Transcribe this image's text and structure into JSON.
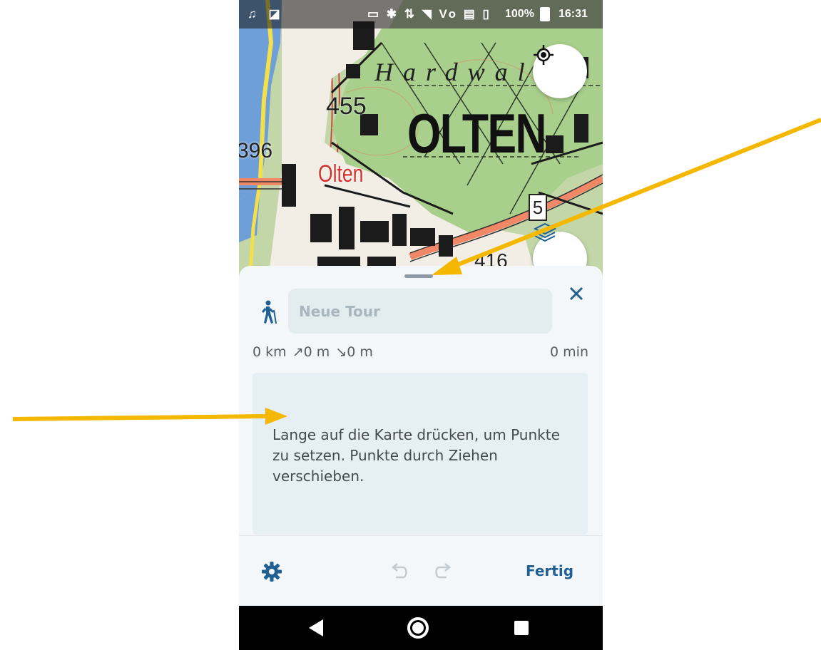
{
  "status_bar": {
    "battery": "100%",
    "time": "16:31"
  },
  "map": {
    "labels": {
      "town": "OLTEN",
      "station": "Olten",
      "forest": "Hardwal",
      "elevation_1": "455",
      "elevation_2": "396",
      "elevation_3": "416",
      "road_number": "5"
    },
    "locate_icon": "crosshair-icon",
    "layers_icon": "layers-icon"
  },
  "sheet": {
    "activity_icon": "hiker-icon",
    "title_placeholder": "Neue Tour",
    "close_icon": "close-icon",
    "stats": {
      "distance": "0 km",
      "ascent": "↗0 m",
      "descent": "↘0 m",
      "duration": "0 min"
    },
    "hint": "Lange auf die Karte drücken, um Punkte zu setzen. Punkte durch Ziehen verschieben."
  },
  "toolbar": {
    "settings_icon": "gear-icon",
    "undo_icon": "undo-icon",
    "redo_icon": "redo-icon",
    "done_label": "Fertig"
  },
  "colors": {
    "accent": "#1f5f92",
    "arrow": "#f5b800"
  }
}
